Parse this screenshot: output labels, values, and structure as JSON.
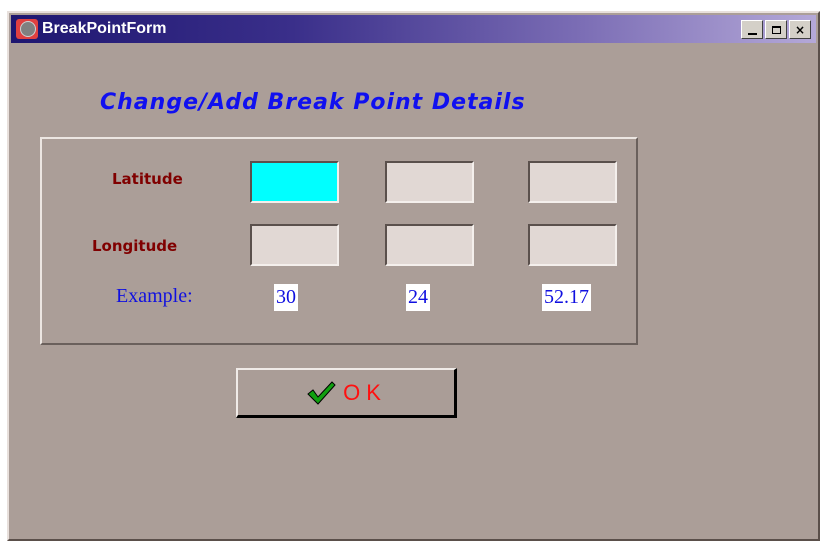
{
  "window": {
    "title": "BreakPointForm",
    "controls": {
      "minimize": "_",
      "maximize": "□",
      "close": "×"
    }
  },
  "form": {
    "heading": "Change/Add Break Point Details",
    "latitude_label": "Latitude",
    "longitude_label": "Longitude",
    "latitude_fields": [
      "",
      "",
      ""
    ],
    "longitude_fields": [
      "",
      "",
      ""
    ],
    "example_label": "Example:",
    "example_values": [
      "30",
      "24",
      "52.17"
    ]
  },
  "ok_button": {
    "label": "OK",
    "icon": "checkmark-icon"
  },
  "colors": {
    "background": "#ab9e98",
    "heading": "#1010f0",
    "field_label": "#800000",
    "active_field": "#00ffff",
    "ok_text": "#ff1010",
    "check": "#10a010"
  }
}
